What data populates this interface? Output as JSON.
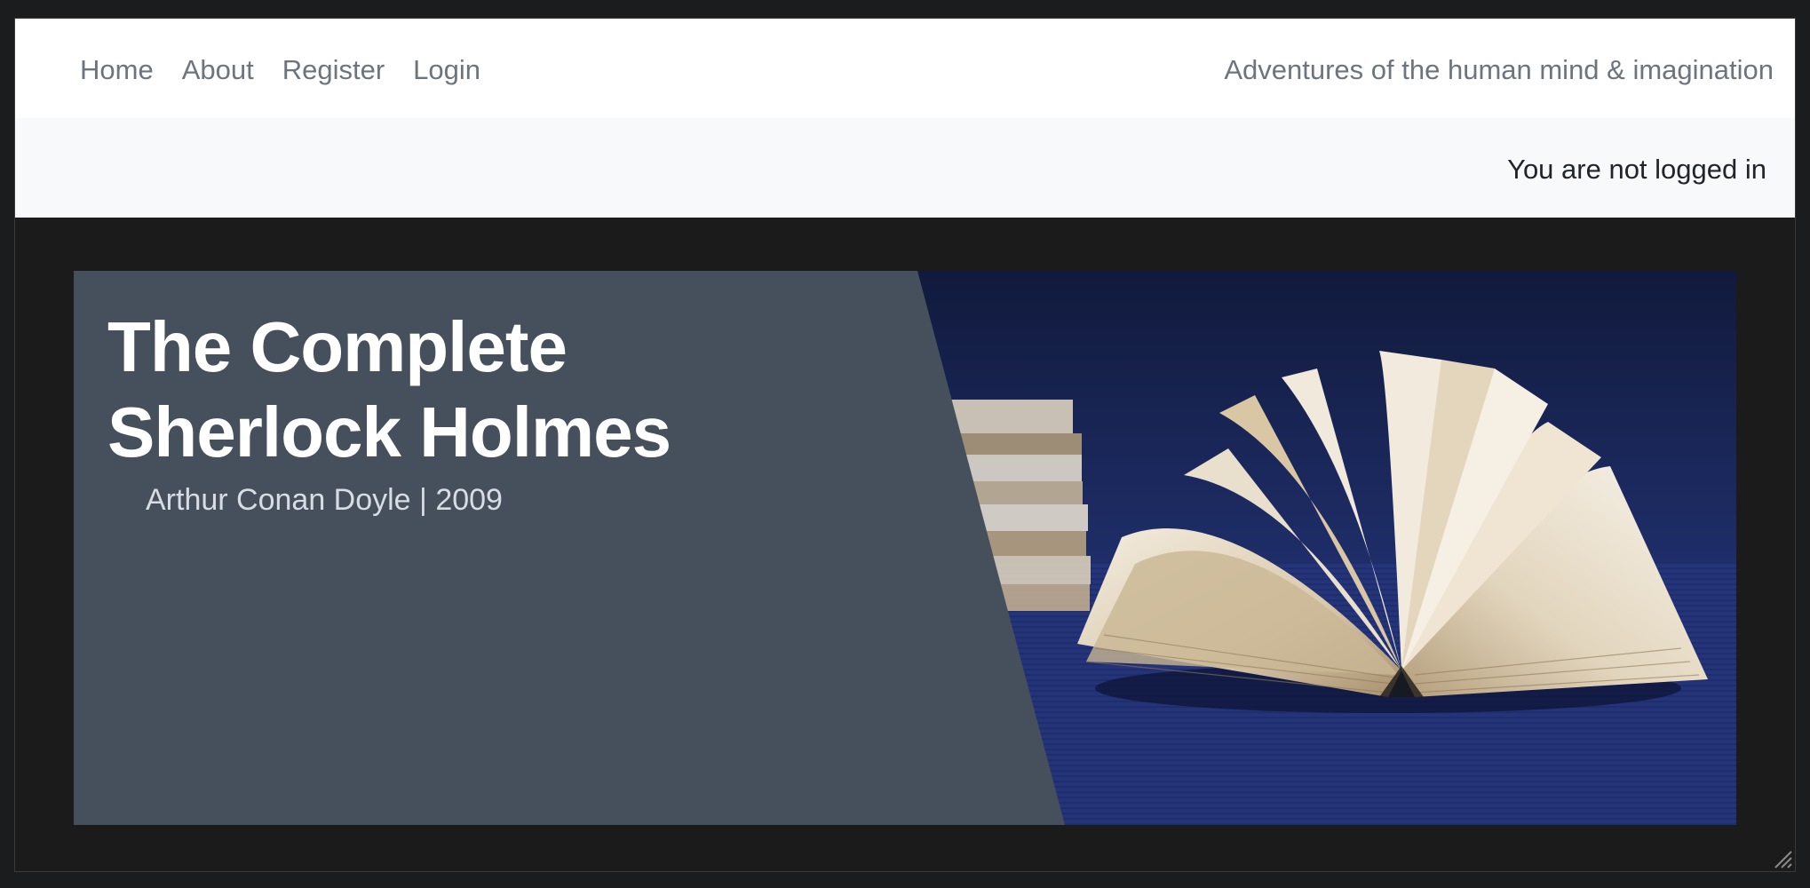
{
  "nav": {
    "links": [
      "Home",
      "About",
      "Register",
      "Login"
    ],
    "tagline": "Adventures of the human mind & imagination"
  },
  "status": {
    "text": "You are not logged in"
  },
  "hero": {
    "title": "The Complete Sherlock Holmes",
    "subtitle": "Arthur Conan Doyle | 2009",
    "panel_color": "#46505d",
    "image_description_icon": "open-book-photo"
  },
  "colors": {
    "page_bg": "#1b1b1b",
    "navbar_bg": "#ffffff",
    "statusbar_bg": "#f8f9fa",
    "nav_text": "#6c757d",
    "status_text": "#212529"
  }
}
